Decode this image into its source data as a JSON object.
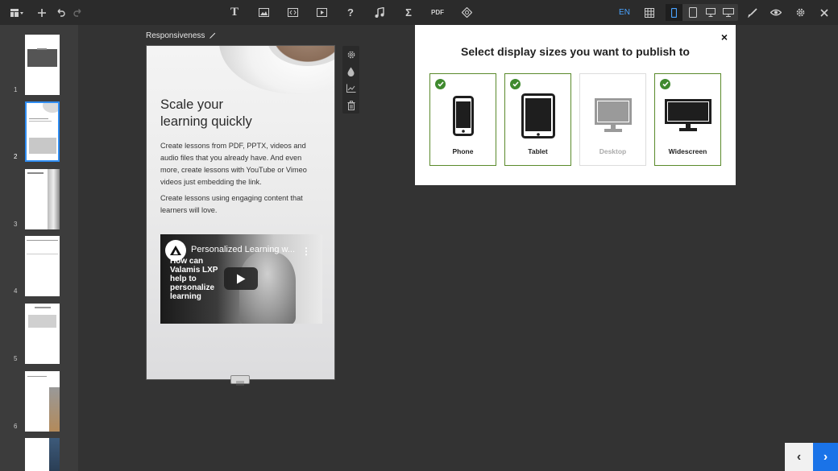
{
  "toolbar": {
    "language": "EN",
    "pdf_label": "PDF",
    "text_tool": "T",
    "help_tool": "?",
    "sum_tool": "Σ",
    "icons": [
      "layout-icon",
      "add-icon",
      "undo-icon",
      "redo-icon",
      "text-icon",
      "image-icon",
      "embed-icon",
      "video-icon",
      "help-icon",
      "audio-icon",
      "math-icon",
      "pdf-icon",
      "shape-icon",
      "grid-icon",
      "phone-icon",
      "tablet-icon",
      "desktop-icon",
      "widescreen-icon",
      "brush-icon",
      "eye-icon",
      "gear-icon",
      "close-icon"
    ]
  },
  "slides_rail": {
    "numbers": [
      "1",
      "2",
      "3",
      "4",
      "5",
      "6"
    ],
    "active": "2"
  },
  "slide": {
    "title": "Responsiveness",
    "heading_line1": "Scale your",
    "heading_line2": "learning quickly",
    "paragraph1": "Create lessons from PDF, PPTX, videos and audio files that you already have. And even more, create lessons with YouTube or Vimeo videos just embedding the link.",
    "paragraph2": "Create lessons using engaging content that learners will love.",
    "video": {
      "title": "Personalized Learning w...",
      "caption": "How can Valamis LXP help to personalize learning",
      "menu": "⋮"
    }
  },
  "dialog": {
    "title": "Select display sizes you want to publish to",
    "close": "×",
    "options": [
      {
        "label": "Phone",
        "selected": true
      },
      {
        "label": "Tablet",
        "selected": true
      },
      {
        "label": "Desktop",
        "selected": false
      },
      {
        "label": "Widescreen",
        "selected": true
      }
    ]
  },
  "navigation": {
    "prev": "‹",
    "next": "›"
  },
  "colors": {
    "accent": "#1a73e8",
    "selected_border": "#5a8a2b",
    "check": "#3f8a2e",
    "toolbar": "#2b2b2b"
  }
}
